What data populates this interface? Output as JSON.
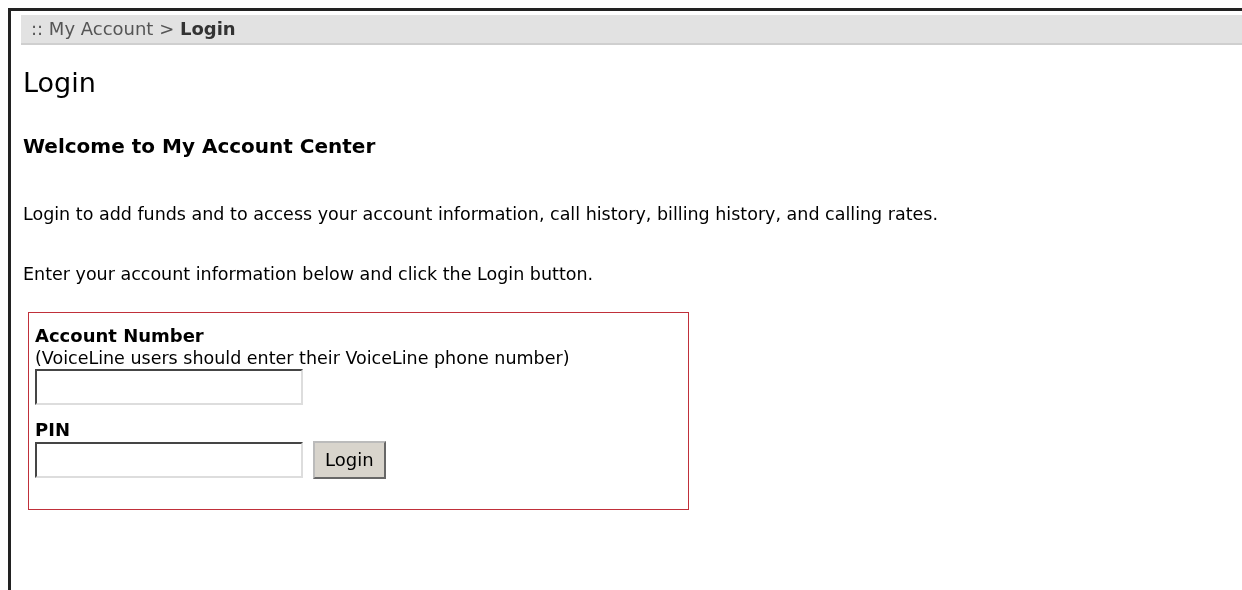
{
  "breadcrumb": ":: My Account > **Login**",
  "page_title": "Login",
  "heading": "Welcome to My Account Center",
  "paragraphs": [
    "Login to add funds and to access your account information, call history, billing history, and calling rates.",
    "Enter your account information below and click the Login button."
  ],
  "form": {
    "fields": [
      {
        "label": "Account Number",
        "hint": "(VoiceLine users should enter their VoiceLine phone number)"
      },
      {
        "label": "PIN"
      }
    ],
    "button": "Login"
  }
}
